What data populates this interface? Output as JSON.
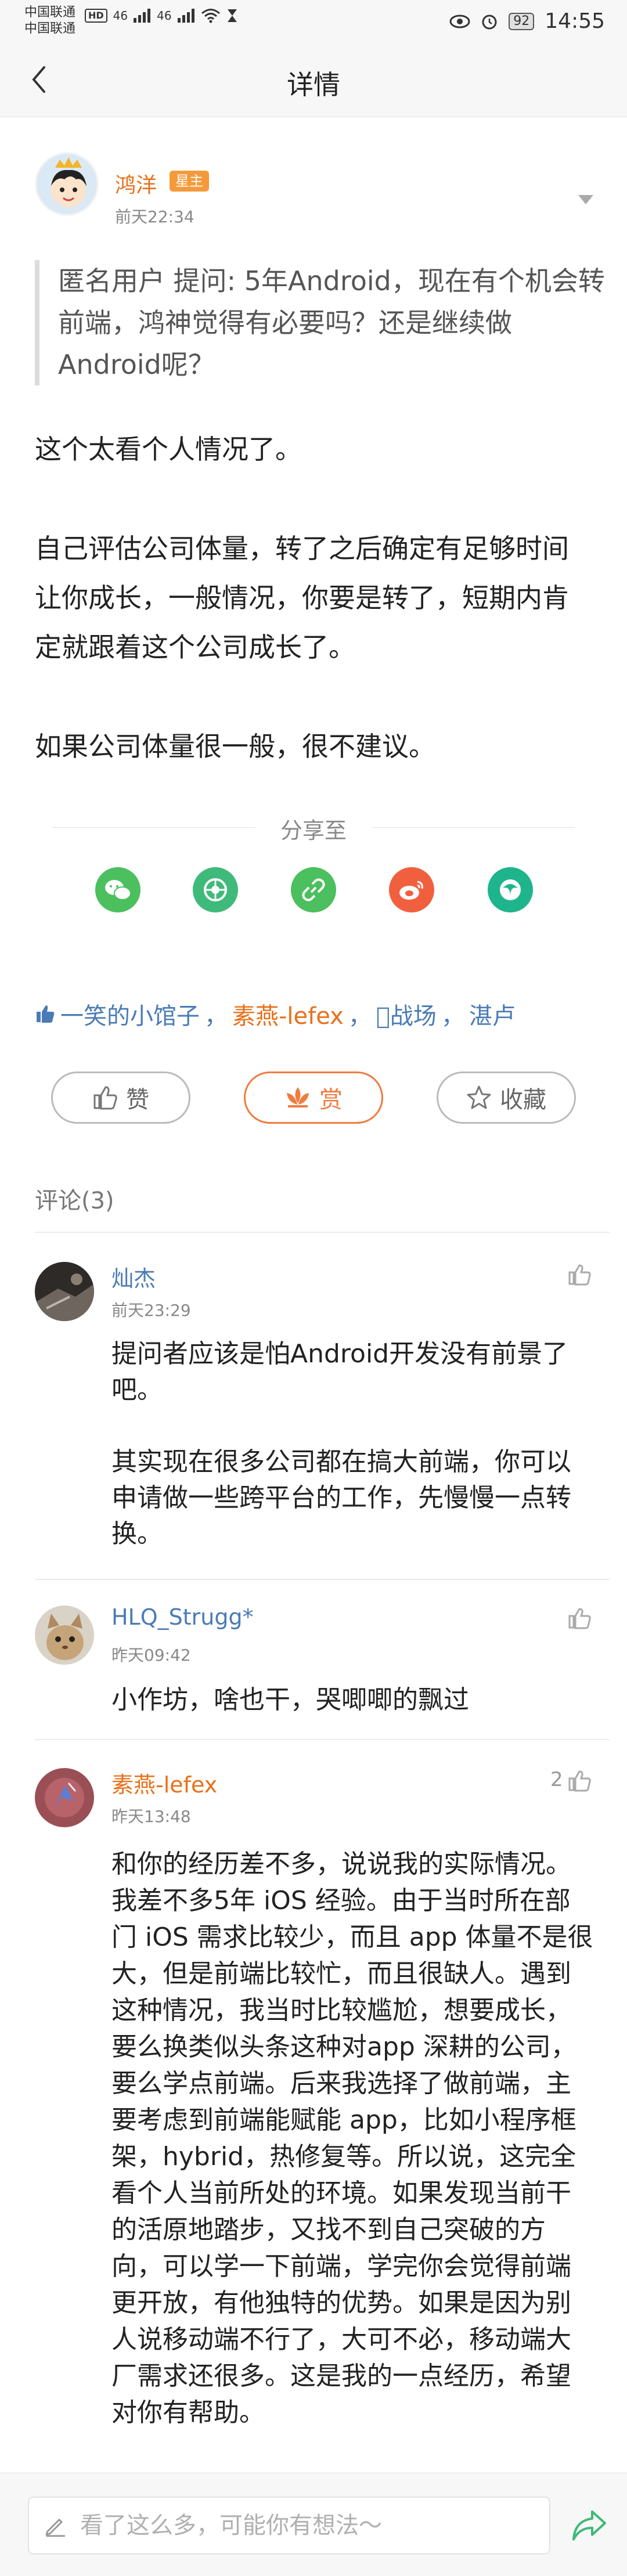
{
  "status_bar": {
    "carrier_1": "中国联通",
    "carrier_2": "中国联通",
    "hd": "HD",
    "net_1": "46",
    "net_2": "46",
    "battery": "92",
    "time": "14:55"
  },
  "header": {
    "title": "详情"
  },
  "post": {
    "author": {
      "name": "鸿洋",
      "badge": "星主",
      "time": "前天22:34"
    },
    "question": {
      "asker": "匿名用户",
      "text": " 提问: 5年Android，现在有个机会转前端，鸿神觉得有必要吗？还是继续做Android呢？"
    },
    "answer": [
      "这个太看个人情况了。",
      "自己评估公司体量，转了之后确定有足够时间让你成长，一般情况，你要是转了，短期内肯定就跟着这个公司成长了。",
      "如果公司体量很一般，很不建议。"
    ]
  },
  "share": {
    "label": "分享至",
    "icons": [
      "wechat-icon",
      "moments-icon",
      "link-icon",
      "weibo-icon",
      "qzone-icon"
    ],
    "colors": [
      "#4cbf5e",
      "#3fba7a",
      "#4cbf5e",
      "#f0603f",
      "#1fb58c"
    ]
  },
  "likers": {
    "names": [
      "一笑的小馆子",
      "素燕-lefex",
      "\u0000战场",
      "湛卢"
    ]
  },
  "actions": {
    "like": "赞",
    "reward": "赏",
    "collect": "收藏"
  },
  "comments": {
    "header": "评论(3)",
    "items": [
      {
        "name": "灿杰",
        "time": "前天23:29",
        "like_count": "",
        "paragraphs": [
          "提问者应该是怕Android开发没有前景了吧。",
          "其实现在很多公司都在搞大前端，你可以申请做一些跨平台的工作，先慢慢一点转换。"
        ]
      },
      {
        "name": "HLQ_Strugg*",
        "time": "昨天09:42",
        "like_count": "",
        "paragraphs": [
          "小作坊，啥也干，哭唧唧的飘过"
        ]
      },
      {
        "name": "素燕-lefex",
        "time": "昨天13:48",
        "like_count": "2",
        "paragraphs": [
          "和你的经历差不多，说说我的实际情况。我差不多5年 iOS 经验。由于当时所在部门 iOS 需求比较少，而且 app 体量不是很大，但是前端比较忙，而且很缺人。遇到这种情况，我当时比较尴尬，想要成长，要么换类似头条这种对app 深耕的公司，要么学点前端。后来我选择了做前端，主要考虑到前端能赋能 app，比如小程序框架，hybrid，热修复等。所以说，这完全看个人当前所处的环境。如果发现当前干的活原地踏步，又找不到自己突破的方向，可以学一下前端，学完你会觉得前端更开放，有他独特的优势。如果是因为别人说移动端不行了，大可不必，移动端大厂需求还很多。这是我的一点经历，希望对你有帮助。"
        ]
      }
    ]
  },
  "input": {
    "placeholder": "看了这么多，可能你有想法～"
  },
  "colors": {
    "accent_orange": "#e8701a",
    "link_blue": "#4a7bb5",
    "reward_orange": "#f07b3f"
  }
}
